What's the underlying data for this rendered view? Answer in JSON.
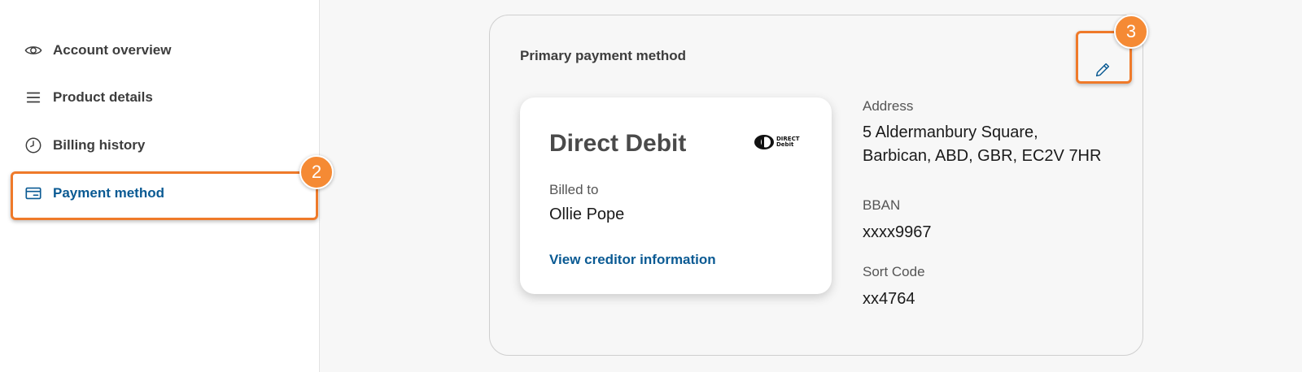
{
  "sidebar": {
    "items": [
      {
        "label": "Account overview",
        "icon": "eye-icon"
      },
      {
        "label": "Product details",
        "icon": "menu-lines-icon"
      },
      {
        "label": "Billing history",
        "icon": "clock-icon"
      },
      {
        "label": "Payment method",
        "icon": "credit-card-icon",
        "active": true
      }
    ]
  },
  "annotations": {
    "step_sidebar": "2",
    "step_edit": "3"
  },
  "payment": {
    "section_title": "Primary payment method",
    "card": {
      "title": "Direct Debit",
      "logo_text_line1": "DIRECT",
      "logo_text_line2": "Debit",
      "billed_label": "Billed to",
      "billed_name": "Ollie Pope",
      "link": "View creditor information"
    },
    "address_label": "Address",
    "address_line1": "5 Aldermanbury Square,",
    "address_line2": "Barbican, ABD, GBR, EC2V 7HR",
    "bban_label": "BBAN",
    "bban_value": "xxxx9967",
    "sort_code_label": "Sort Code",
    "sort_code_value": "xx4764"
  },
  "colors": {
    "accent": "#0a5a93",
    "highlight": "#ef7a2a",
    "badge": "#f58a34"
  }
}
